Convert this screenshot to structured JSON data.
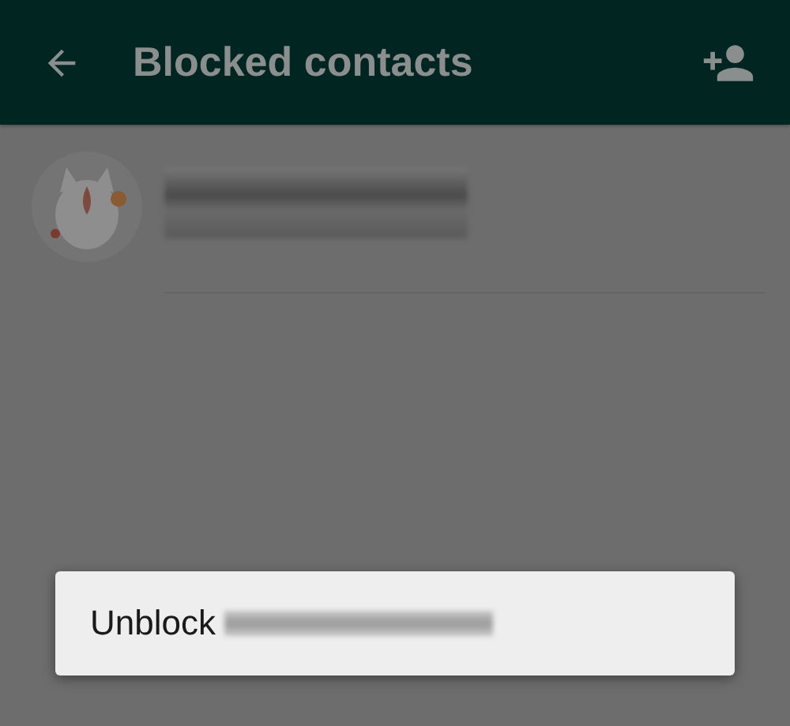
{
  "app_bar": {
    "title": "Blocked contacts"
  },
  "contacts": [
    {
      "redacted": true
    }
  ],
  "dialog": {
    "items": [
      {
        "label": "Unblock",
        "redacted": true
      }
    ]
  }
}
